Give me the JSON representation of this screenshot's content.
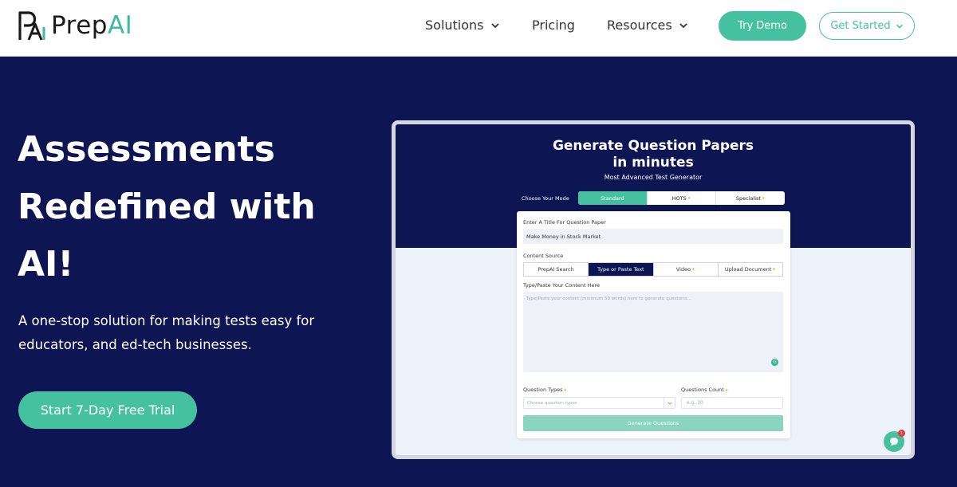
{
  "header": {
    "logo": {
      "prep": "Prep",
      "ai": "AI"
    },
    "nav": [
      {
        "label": "Solutions",
        "dropdown": true
      },
      {
        "label": "Pricing",
        "dropdown": false
      },
      {
        "label": "Resources",
        "dropdown": true
      }
    ],
    "try_demo": "Try Demo",
    "get_started": "Get Started"
  },
  "hero": {
    "title_line1": "Assessments",
    "title_line2": "Redefined with",
    "title_line3": "AI!",
    "subtitle": "A one-stop solution for making tests easy for educators, and ed-tech businesses.",
    "cta": "Start 7-Day Free Trial"
  },
  "mockup": {
    "title_line1": "Generate Question Papers",
    "title_line2": "in minutes",
    "subtitle": "Most Advanced Test Generator",
    "mode_label": "Choose Your Mode",
    "modes": [
      {
        "label": "Standard",
        "active": true,
        "pro": false
      },
      {
        "label": "HOTS",
        "active": false,
        "pro": true
      },
      {
        "label": "Specialist",
        "active": false,
        "pro": true
      }
    ],
    "title_label": "Enter A Title For Question Paper",
    "title_value": "Make Money in Stock Market",
    "content_source_label": "Content Source",
    "sources": [
      {
        "label": "PrepAI Search",
        "active": false,
        "pro": false
      },
      {
        "label": "Type or Paste Text",
        "active": true,
        "pro": false
      },
      {
        "label": "Video",
        "active": false,
        "pro": true
      },
      {
        "label": "Upload Document",
        "active": false,
        "pro": true
      }
    ],
    "content_label": "Type/Paste Your Content Here",
    "content_placeholder": "Type/Paste your content (minimum 50 words) here to generate questions...",
    "question_types_label": "Question Types",
    "question_types_placeholder": "Choose question types",
    "questions_count_label": "Questions Count",
    "questions_count_placeholder": "e.g. 30",
    "generate_button": "Generate Questions",
    "pro_badge": "★",
    "chat_badge": "1"
  },
  "colors": {
    "navy": "#0d1552",
    "accent": "#46c1a0",
    "accent_light": "#8bd4bd"
  }
}
